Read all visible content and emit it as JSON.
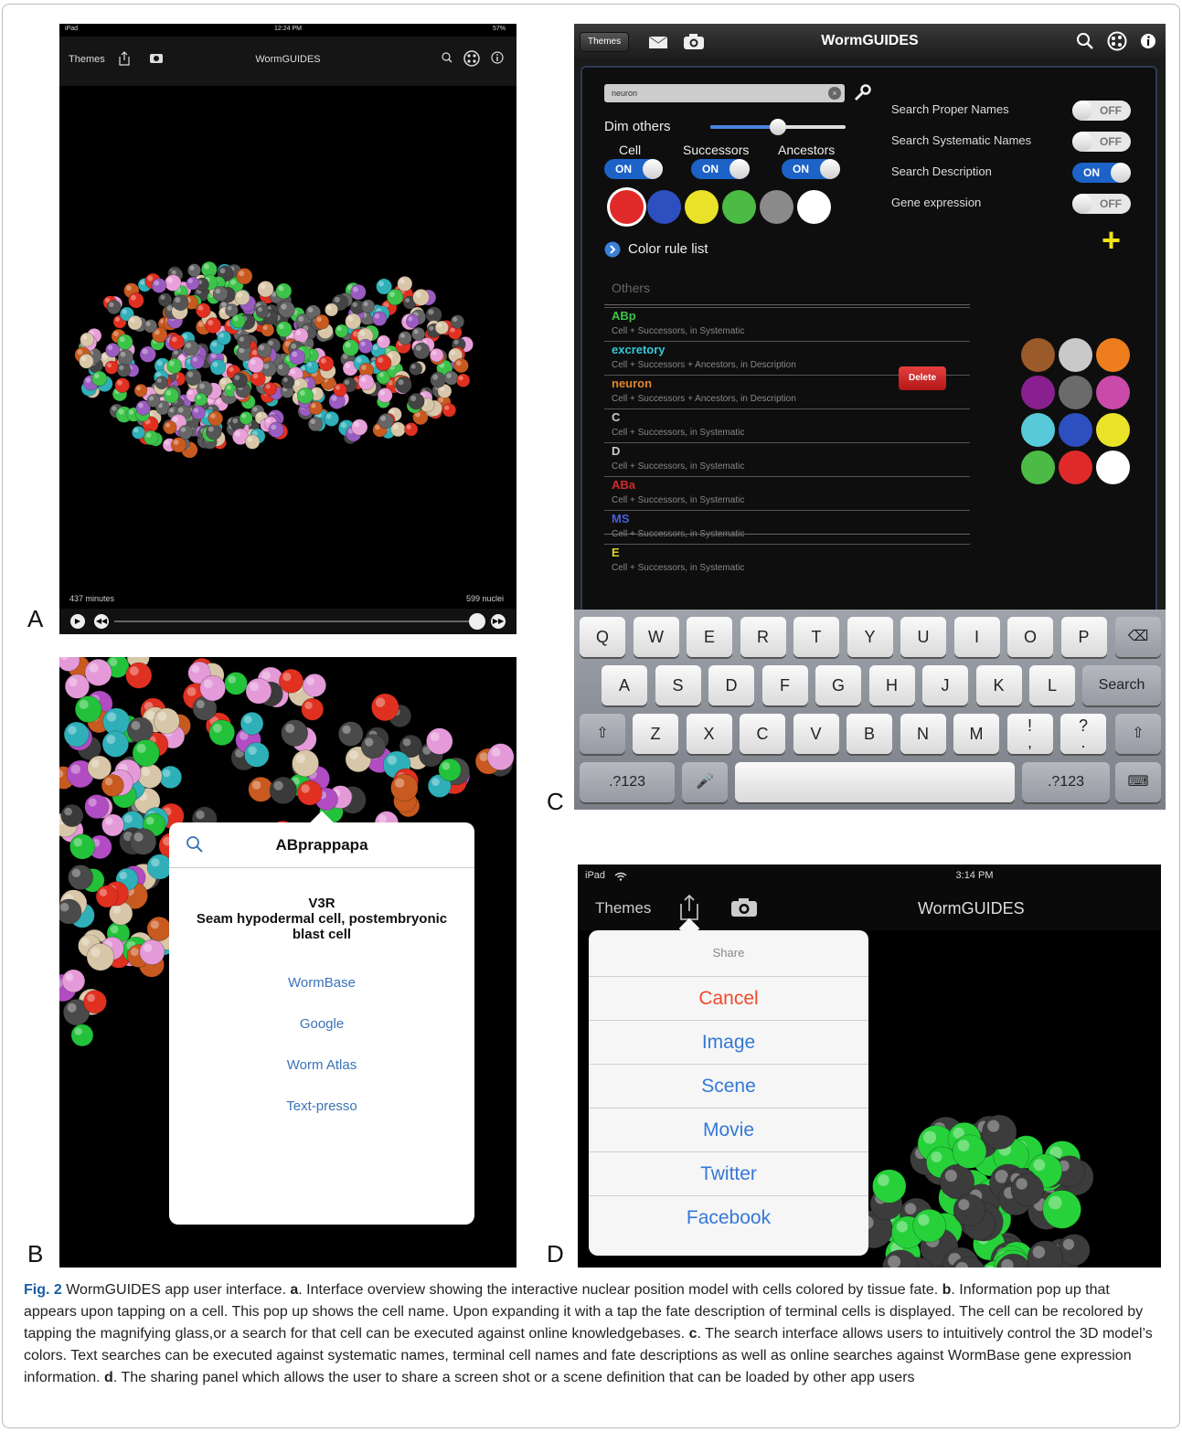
{
  "panel_letters": {
    "a": "A",
    "b": "B",
    "c": "C",
    "d": "D"
  },
  "panel_a": {
    "status_left": "iPad",
    "status_time": "12:24 PM",
    "status_right": "57%",
    "themes_label": "Themes",
    "title": "WormGUIDES",
    "time_label": "437 minutes",
    "nuclei_label": "599 nuclei"
  },
  "panel_b": {
    "cell_name": "ABprappapa",
    "fate_name": "V3R",
    "fate_description_1": "Seam hypodermal cell, postembryonic",
    "fate_description_2": "blast cell",
    "links": [
      "WormBase",
      "Google",
      "Worm Atlas",
      "Text-presso"
    ]
  },
  "panel_c": {
    "themes_label": "Themes",
    "title": "WormGUIDES",
    "search_value": "neuron",
    "dim_others_label": "Dim others",
    "dim_others_level": 0.5,
    "toggles_left": [
      {
        "label": "Cell",
        "state": "ON"
      },
      {
        "label": "Successors",
        "state": "ON"
      },
      {
        "label": "Ancestors",
        "state": "ON"
      }
    ],
    "search_options": [
      {
        "label": "Search Proper Names",
        "state": "OFF"
      },
      {
        "label": "Search Systematic Names",
        "state": "OFF"
      },
      {
        "label": "Search Description",
        "state": "ON"
      },
      {
        "label": "Gene expression",
        "state": "OFF"
      }
    ],
    "swatches": [
      "#e02a2a",
      "#2e4fc0",
      "#e9e228",
      "#4cbb45",
      "#8a8a8a",
      "#ffffff"
    ],
    "color_rule_list_label": "Color rule list",
    "others_label": "Others",
    "rules": [
      {
        "name": "ABp",
        "color": "#3cc34a",
        "desc": "Cell + Successors, in Systematic"
      },
      {
        "name": "excretory",
        "color": "#35c8d6",
        "desc": "Cell + Successors + Ancestors, in Description"
      },
      {
        "name": "neuron",
        "color": "#e1862d",
        "desc": "Cell + Successors + Ancestors, in Description"
      },
      {
        "name": "C",
        "color": "#cccccc",
        "desc": "Cell + Successors, in Systematic"
      },
      {
        "name": "D",
        "color": "#cccccc",
        "desc": "Cell + Successors, in Systematic"
      },
      {
        "name": "ABa",
        "color": "#d42a2a",
        "desc": "Cell + Successors, in Systematic"
      },
      {
        "name": "MS",
        "color": "#4a5fd6",
        "desc": "Cell + Successors, in Systematic"
      },
      {
        "name": "E",
        "color": "#d9d22e",
        "desc": "Cell + Successors, in Systematic"
      }
    ],
    "delete_label": "Delete",
    "add_label": "+",
    "palette": [
      "#9b5a2a",
      "#c9c9c9",
      "#ee7d1e",
      "#8a2090",
      "#6b6b6b",
      "#c94aa8",
      "#57c9d8",
      "#2e4fc0",
      "#e9e228",
      "#4cbb45",
      "#e02a2a",
      "#ffffff"
    ],
    "keyboard": {
      "row1": [
        "Q",
        "W",
        "E",
        "R",
        "T",
        "Y",
        "U",
        "I",
        "O",
        "P"
      ],
      "row2": [
        "A",
        "S",
        "D",
        "F",
        "G",
        "H",
        "J",
        "K",
        "L"
      ],
      "row3": [
        "Z",
        "X",
        "C",
        "V",
        "B",
        "N",
        "M",
        "!\n,",
        "?\n."
      ],
      "search_label": "Search",
      "numbers_label": ".?123"
    }
  },
  "panel_d": {
    "status_left": "iPad",
    "status_time": "3:14 PM",
    "themes_label": "Themes",
    "title": "WormGUIDES",
    "share_header": "Share",
    "cancel_label": "Cancel",
    "options": [
      "Image",
      "Scene",
      "Movie",
      "Twitter",
      "Facebook"
    ]
  },
  "caption": {
    "fig": "Fig. 2",
    "text_1": " WormGUIDES app user interface. ",
    "a": "a",
    "text_a": ". Interface overview showing the interactive nuclear position model with cells colored by tissue fate. ",
    "b": "b",
    "text_b": ". Information pop up that appears upon tapping on a cell. This pop up shows the cell name. Upon expanding it with a tap the fate description of terminal cells is displayed. The cell can be recolored by tapping the magnifying glass,or a search for that cell can be executed against online knowledgebases. ",
    "c": "c",
    "text_c": ". The search interface allows users to intuitively control the 3D model’s colors. Text searches can be executed against systematic names, terminal cell names and fate descriptions as well as online searches against WormBase gene expression information. ",
    "d": "d",
    "text_d": ". The sharing panel which allows the user to share a screen shot or a scene definition that can be loaded by other app users"
  }
}
